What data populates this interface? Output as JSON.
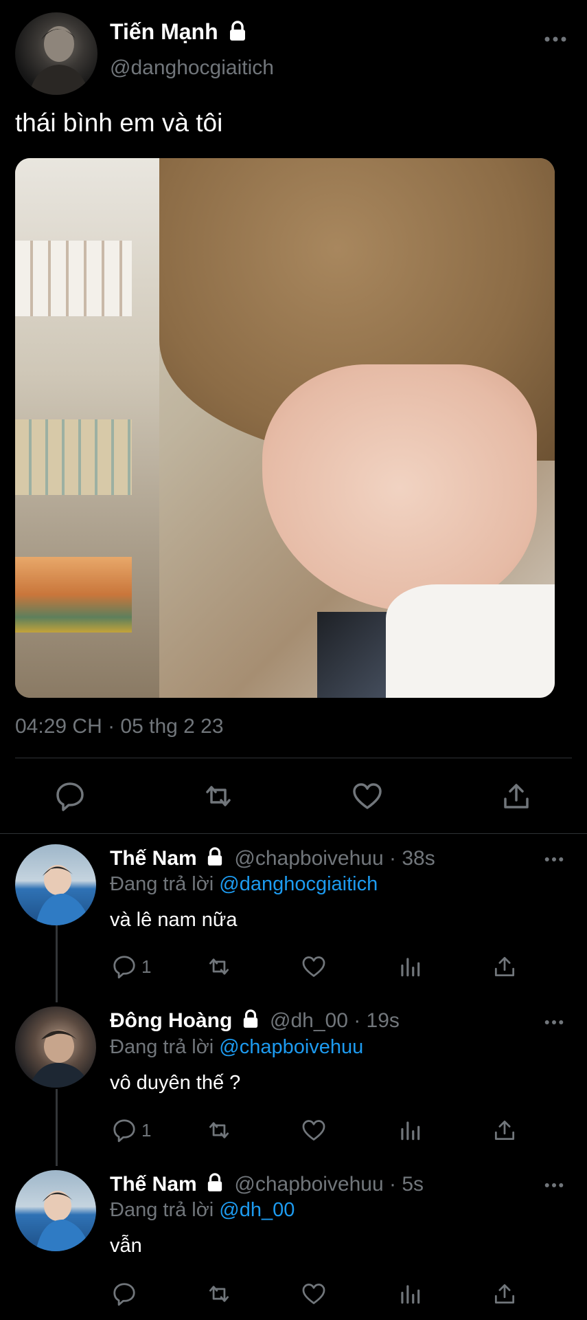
{
  "main_tweet": {
    "display_name": "Tiến Mạnh",
    "handle": "@danghocgiaitich",
    "text": "thái bình em và tôi",
    "timestamp": "04:29 CH · 05 thg 2 23",
    "actions": [
      "reply-icon",
      "retweet-icon",
      "like-icon",
      "share-icon"
    ]
  },
  "replies": [
    {
      "display_name": "Thế Nam",
      "handle_time": "@chapboivehuu · 38s",
      "replying_prefix": "Đang trả lời",
      "replying_to": "@danghocgiaitich",
      "text": "và lê nam nữa",
      "reply_count": "1"
    },
    {
      "display_name": "Đông Hoàng",
      "handle_time": "@dh_00 · 19s",
      "replying_prefix": "Đang trả lời",
      "replying_to": "@chapboivehuu",
      "text": "vô duyên thế ?",
      "reply_count": "1"
    },
    {
      "display_name": "Thế Nam",
      "handle_time": "@chapboivehuu · 5s",
      "replying_prefix": "Đang trả lời",
      "replying_to": "@dh_00",
      "text": "vẫn",
      "reply_count": ""
    }
  ],
  "colors": {
    "background": "#000000",
    "text": "#e7e9ea",
    "muted": "#71767b",
    "link": "#1d9bf0",
    "divider": "#2f3336"
  }
}
